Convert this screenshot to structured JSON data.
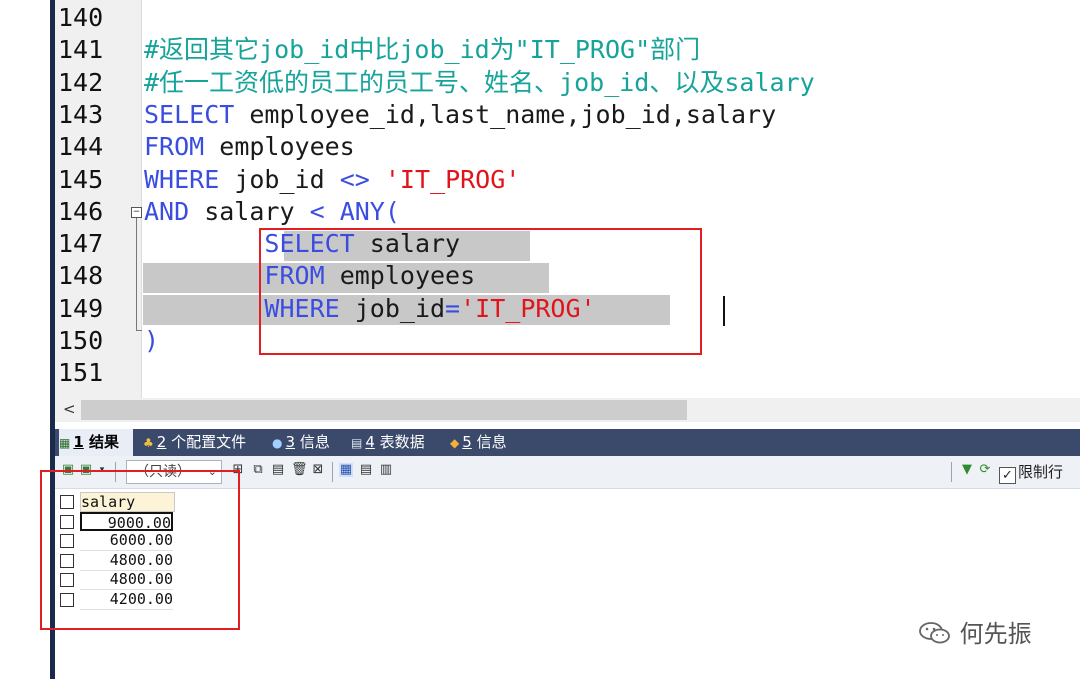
{
  "editor": {
    "lines": [
      {
        "num": "140",
        "parts": []
      },
      {
        "num": "141",
        "parts": [
          {
            "t": "#返回其它job_id中比job_id为\"IT_PROG\"部门",
            "c": "cmt"
          }
        ]
      },
      {
        "num": "142",
        "parts": [
          {
            "t": "#任一工资低的员工的员工号、姓名、job_id、以及salary",
            "c": "cmt"
          }
        ]
      },
      {
        "num": "143",
        "parts": [
          {
            "t": "SELECT",
            "c": "kw"
          },
          {
            "t": " employee_id,last_name,job_id,salary",
            "c": "txt"
          }
        ]
      },
      {
        "num": "144",
        "parts": [
          {
            "t": "FROM",
            "c": "kw"
          },
          {
            "t": " employees",
            "c": "txt"
          }
        ]
      },
      {
        "num": "145",
        "parts": [
          {
            "t": "WHERE",
            "c": "kw"
          },
          {
            "t": " job_id ",
            "c": "txt"
          },
          {
            "t": "<>",
            "c": "kw"
          },
          {
            "t": " ",
            "c": "txt"
          },
          {
            "t": "'IT_PROG'",
            "c": "str"
          }
        ]
      },
      {
        "num": "146",
        "parts": [
          {
            "t": "AND",
            "c": "kw"
          },
          {
            "t": " salary ",
            "c": "txt"
          },
          {
            "t": "<",
            "c": "kw"
          },
          {
            "t": " ",
            "c": "txt"
          },
          {
            "t": "ANY(",
            "c": "kw"
          }
        ]
      },
      {
        "num": "147",
        "parts": [
          {
            "t": "        ",
            "c": "txt"
          },
          {
            "t": "SELECT",
            "c": "kw"
          },
          {
            "t": " salary ",
            "c": "txt"
          }
        ]
      },
      {
        "num": "148",
        "parts": [
          {
            "t": "        ",
            "c": "txt"
          },
          {
            "t": "FROM",
            "c": "kw"
          },
          {
            "t": " employees ",
            "c": "txt"
          }
        ]
      },
      {
        "num": "149",
        "parts": [
          {
            "t": "        ",
            "c": "txt"
          },
          {
            "t": "WHERE",
            "c": "kw"
          },
          {
            "t": " job_id",
            "c": "txt"
          },
          {
            "t": "=",
            "c": "kw"
          },
          {
            "t": "'IT_PROG'",
            "c": "str"
          }
        ]
      },
      {
        "num": "150",
        "parts": [
          {
            "t": ")",
            "c": "kw"
          }
        ]
      },
      {
        "num": "151",
        "parts": []
      }
    ]
  },
  "tabs": [
    {
      "num": "1",
      "label": "结果",
      "icon": "results-icon"
    },
    {
      "num": "2",
      "label": "个配置文件",
      "icon": "profile-icon"
    },
    {
      "num": "3",
      "label": "信息",
      "icon": "info-icon"
    },
    {
      "num": "4",
      "label": "表数据",
      "icon": "table-data-icon"
    },
    {
      "num": "5",
      "label": "信息",
      "icon": "info2-icon"
    }
  ],
  "toolbar": {
    "readonly_label": "（只读）",
    "limit_label": "限制行"
  },
  "grid": {
    "header": "salary",
    "rows": [
      "9000.00",
      "6000.00",
      "4800.00",
      "4800.00",
      "4200.00"
    ]
  },
  "watermark": {
    "text": "何先振"
  }
}
